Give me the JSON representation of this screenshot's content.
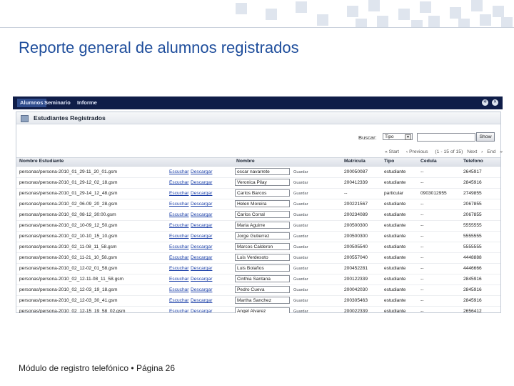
{
  "slide": {
    "title": "Reporte general de alumnos registrados",
    "footer": "Módulo de registro telefónico • Página 26"
  },
  "app": {
    "nav_tabs": [
      "Alumnos",
      "Seminario",
      "Informe"
    ],
    "active_tab": "Alumnos",
    "panel_title": "Estudiantes Registrados",
    "search": {
      "label": "Buscar:",
      "field_value": "Tipo",
      "query": "",
      "button": "Show"
    },
    "pager": {
      "start": "Start",
      "previous": "Previous",
      "range": "(1 - 15 of 15)",
      "next": "Next",
      "end": "End"
    },
    "columns": [
      "Nombre Estudiante",
      "Nombre",
      "Matricula",
      "Tipo",
      "Cedula",
      "Telefono"
    ],
    "row_actions": {
      "listen": "Escuchar",
      "download": "Descargar",
      "save": "Guardar"
    },
    "rows": [
      {
        "file": "personas/persona-2010_01_29-11_20_01.gsm",
        "name": "oscar navarrete",
        "matricula": "200050087",
        "tipo": "estudiante",
        "cedula": "--",
        "telefono": "2645917"
      },
      {
        "file": "personas/persona-2010_01_29-12_02_18.gsm",
        "name": "Veronica Pilay",
        "matricula": "200412339",
        "tipo": "estudiante",
        "cedula": "--",
        "telefono": "2845916"
      },
      {
        "file": "personas/persona-2010_01_29-14_12_48.gsm",
        "name": "Carlos Barcos",
        "matricula": "--",
        "tipo": "particular",
        "cedula": "0903012955",
        "telefono": "2749855"
      },
      {
        "file": "personas/persona-2010_02_06-09_20_28.gsm",
        "name": "Helen Moreira",
        "matricula": "200221567",
        "tipo": "estudiante",
        "cedula": "--",
        "telefono": "2067855"
      },
      {
        "file": "personas/persona-2010_02_08-12_30:00.gsm",
        "name": "Carlos Corral",
        "matricula": "200234089",
        "tipo": "estudiante",
        "cedula": "--",
        "telefono": "2067855"
      },
      {
        "file": "personas/persona-2010_02_10-09_12_50.gsm",
        "name": "Maria Aguirre",
        "matricula": "200500300",
        "tipo": "estudiante",
        "cedula": "--",
        "telefono": "5555555"
      },
      {
        "file": "personas/persona-2010_02_10-10_15_10.gsm",
        "name": "Jorge Gutierrez",
        "matricula": "200500300",
        "tipo": "estudiante",
        "cedula": "--",
        "telefono": "5555555"
      },
      {
        "file": "personas/persona-2010_02_11-08_11_58.gsm",
        "name": "Marcos Calderon",
        "matricula": "200505540",
        "tipo": "estudiante",
        "cedula": "--",
        "telefono": "5555555"
      },
      {
        "file": "personas/persona-2010_02_11-21_10_58.gsm",
        "name": "Luis Verdesoto",
        "matricula": "200557040",
        "tipo": "estudiante",
        "cedula": "--",
        "telefono": "4448888"
      },
      {
        "file": "personas/persona-2010_02_12-02_01_58.gsm",
        "name": "Luis Bolaños",
        "matricula": "200452281",
        "tipo": "estudiante",
        "cedula": "--",
        "telefono": "4446666"
      },
      {
        "file": "personas/persona-2010_02_12-11-08_11_58.gsm",
        "name": "Cinthia Santana",
        "matricula": "200122339",
        "tipo": "estudiante",
        "cedula": "--",
        "telefono": "2845916"
      },
      {
        "file": "personas/persona-2010_02_12-03_19_18.gsm",
        "name": "Pedro Cueva",
        "matricula": "200042030",
        "tipo": "estudiante",
        "cedula": "--",
        "telefono": "2845916"
      },
      {
        "file": "personas/persona-2010_02_12-03_30_41.gsm",
        "name": "Martha Sanchez",
        "matricula": "200305463",
        "tipo": "estudiante",
        "cedula": "--",
        "telefono": "2845916"
      },
      {
        "file": "personas/persona-2010_02_12-15_19_58_02.gsm",
        "name": "Angel Alvarez",
        "matricula": "200022339",
        "tipo": "estudiante",
        "cedula": "--",
        "telefono": "2656412"
      }
    ]
  },
  "icons": {
    "settings": "gear-icon",
    "close": "close-icon",
    "panel": "table-icon",
    "dropdown": "chevron-down-icon"
  },
  "colors": {
    "title": "#1f4e9c",
    "navbar": "#0f1d48",
    "link": "#1a3fa8"
  }
}
